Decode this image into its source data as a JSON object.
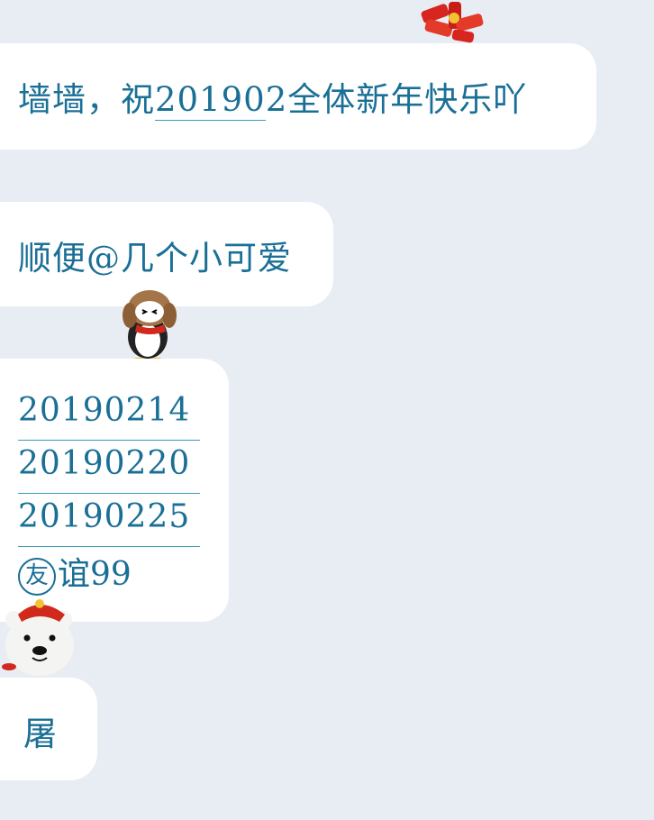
{
  "messages": [
    {
      "id": "m1",
      "segments": [
        {
          "text": "墙墙，祝"
        },
        {
          "text": "20190",
          "underline": true
        },
        {
          "text": "2全体新年快乐吖"
        }
      ]
    },
    {
      "id": "m2",
      "text": "顺便@几个小可爱"
    },
    {
      "id": "m3",
      "dates": [
        "20190214",
        "20190220",
        "20190225"
      ],
      "last_circled": "友",
      "last_rest": "谊99"
    },
    {
      "id": "m4",
      "text": "屠"
    }
  ],
  "stickers": {
    "firecracker": "firecracker-sticker",
    "penguin": "penguin-sticker",
    "polar_bear": "polar-bear-sticker"
  },
  "colors": {
    "background": "#e8edf4",
    "bubble": "#ffffff",
    "text": "#1a6f96",
    "link_underline": "#3a9bb8"
  }
}
